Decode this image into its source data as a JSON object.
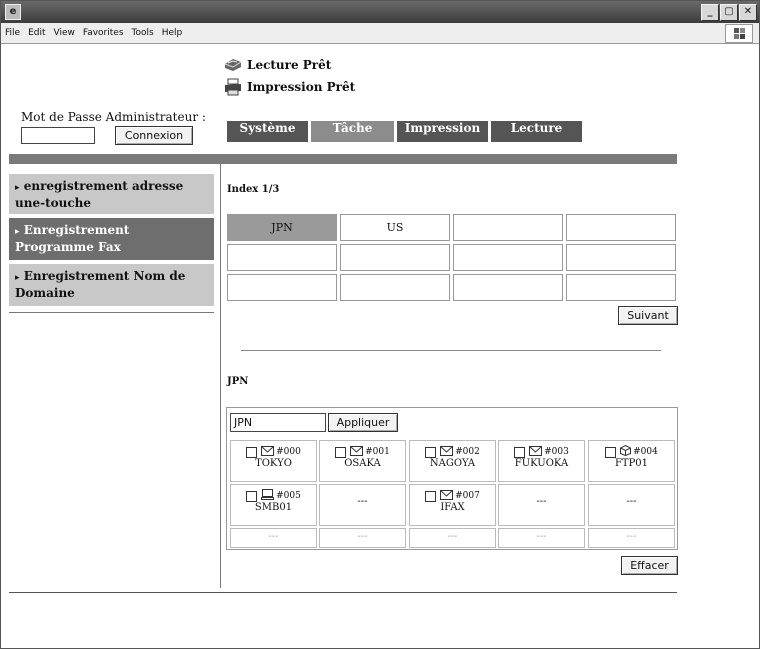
{
  "window": {
    "app_icon": "ie-window-icon",
    "controls": [
      "_",
      "▢",
      "✕"
    ]
  },
  "menu": {
    "items": [
      "File",
      "Edit",
      "View",
      "Favorites",
      "Tools",
      "Help"
    ]
  },
  "brand": {
    "line1": "Lecture Prêt",
    "line2": "Impression Prêt"
  },
  "admin": {
    "label": "Mot de Passe Administrateur :",
    "password_value": "",
    "login_label": "Connexion"
  },
  "tabs": [
    "Système",
    "Tâche",
    "Impression",
    "Lecture"
  ],
  "sidebar": {
    "items": [
      {
        "label": "enregistrement adresse une-touche"
      },
      {
        "label": "Enregistrement Programme Fax"
      },
      {
        "label": "Enregistrement Nom de Domaine"
      }
    ]
  },
  "index": {
    "heading": "Index 1/3",
    "cells": [
      "JPN",
      "US",
      "",
      "",
      "",
      "",
      "",
      "",
      "",
      "",
      "",
      ""
    ],
    "next_label": "Suivant"
  },
  "directory": {
    "heading": "JPN",
    "input_value": "JPN",
    "apply_label": "Appliquer",
    "entries": [
      {
        "icon": "mail-icon",
        "num": "#000",
        "name": "TOKYO"
      },
      {
        "icon": "mail-icon",
        "num": "#001",
        "name": "OSAKA"
      },
      {
        "icon": "mail-icon",
        "num": "#002",
        "name": "NAGOYA"
      },
      {
        "icon": "mail-icon",
        "num": "#003",
        "name": "FUKUOKA"
      },
      {
        "icon": "ftp-icon",
        "num": "#004",
        "name": "FTP01"
      },
      {
        "icon": "smb-icon",
        "num": "#005",
        "name": "SMB01"
      },
      {
        "empty": "---"
      },
      {
        "icon": "mail-icon",
        "num": "#007",
        "name": "IFAX"
      },
      {
        "empty": "---"
      },
      {
        "empty": "---"
      },
      {
        "empty": "---"
      },
      {
        "empty": "---"
      },
      {
        "empty": "---"
      },
      {
        "empty": "---"
      },
      {
        "empty": "---"
      }
    ],
    "clear_label": "Effacer"
  }
}
